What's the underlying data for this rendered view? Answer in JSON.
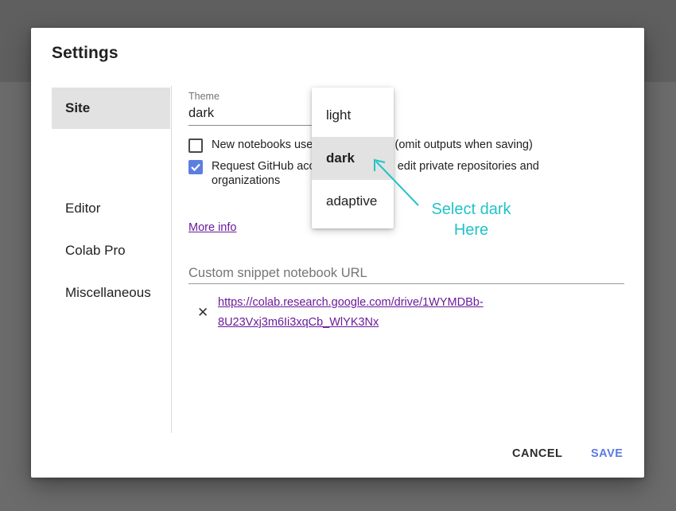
{
  "dialog": {
    "title": "Settings"
  },
  "sidebar": {
    "items": [
      {
        "label": "Site"
      },
      {
        "label": "Editor"
      },
      {
        "label": "Colab Pro"
      },
      {
        "label": "Miscellaneous"
      }
    ]
  },
  "site": {
    "theme_label": "Theme",
    "theme_value": "dark",
    "options": [
      {
        "label": "New notebooks use private outputs (omit outputs when saving)",
        "checked": false
      },
      {
        "label": "Request GitHub access to read and edit private repositories and",
        "label_line2": "organizations",
        "checked": true
      }
    ],
    "more_info": "More info",
    "snippet_label": "Custom snippet notebook URL",
    "snippet_url_line1": "https://colab.research.google.com/drive/1WYMDBb-",
    "snippet_url_line2": "8U23Vxj3m6Ii3xqCb_WlYK3Nx",
    "remove_symbol": "✕"
  },
  "dropdown": {
    "items": [
      {
        "label": "light"
      },
      {
        "label": "dark"
      },
      {
        "label": "adaptive"
      }
    ],
    "selected": "dark"
  },
  "buttons": {
    "cancel": "CANCEL",
    "save": "SAVE"
  },
  "annotation": {
    "line1": "Select dark",
    "line2": "Here",
    "color": "#22c3c6"
  },
  "colors": {
    "accent": "#5a7be0",
    "link": "#6a1b9a",
    "selected_bg": "#e2e2e2"
  }
}
